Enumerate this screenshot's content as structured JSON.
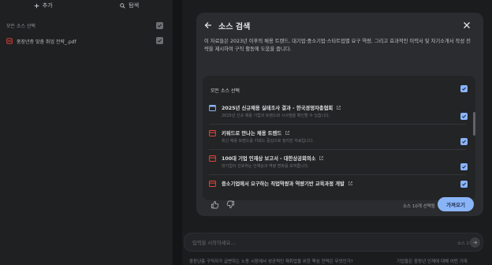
{
  "left_panel": {
    "add_label": "추가",
    "search_label": "탐색",
    "select_all_label": "모든 소스 선택",
    "sources": [
      {
        "name": "중장년층 맞춤 취업 전략_.pdf",
        "checked": true
      }
    ]
  },
  "modal": {
    "title": "소스 검색",
    "description": "이 자료들은 2023년 이후의 채용 트렌드, 대기업·중소기업·스타트업별 요구 역량, 그리고 효과적인 이력서 및 자기소개서 작성 전략을 제시하여 구직 활동에 도움을 줍니다.",
    "select_all_label": "모든 소스 선택",
    "items": [
      {
        "title": "2025년 신규채용 실태조사 결과 - 한국경영자총협회",
        "subtitle": "2025년 신규 채용 기업의 트렌드와 시사점을 확인할 수 있습니다.",
        "icon": "web-icon",
        "checked": true
      },
      {
        "title": "키워드로 만나는 채용 트렌드",
        "subtitle": "최신 채용 트렌드를 키워드 중심으로 정리한 자료입니다.",
        "icon": "doc-icon",
        "checked": true
      },
      {
        "title": "100대 기업 인재상 보고서 - 대한상공회의소",
        "subtitle": "대기업이 선호하는 인재상과 역량 변화를 보여줍니다.",
        "icon": "doc-icon",
        "checked": true
      },
      {
        "title": "중소기업에서 요구하는 직업역량과 역량기반 교육과정 개발",
        "subtitle": "",
        "icon": "doc-icon",
        "checked": true
      }
    ],
    "count_label": "소스 10개 선택됨",
    "insert_label": "가져오기",
    "accent": "#8ab4f8"
  },
  "chat": {
    "placeholder": "입력을 시작하세요...",
    "count": "소스 1개",
    "suggestions": [
      "중장년층 구직자가 급변하는 노동 시장에서 성공적인 재취업을 위한 핵심 전략은 무엇인가?",
      "기업들은 중장년 인재에 대해 어떤 기대"
    ]
  }
}
